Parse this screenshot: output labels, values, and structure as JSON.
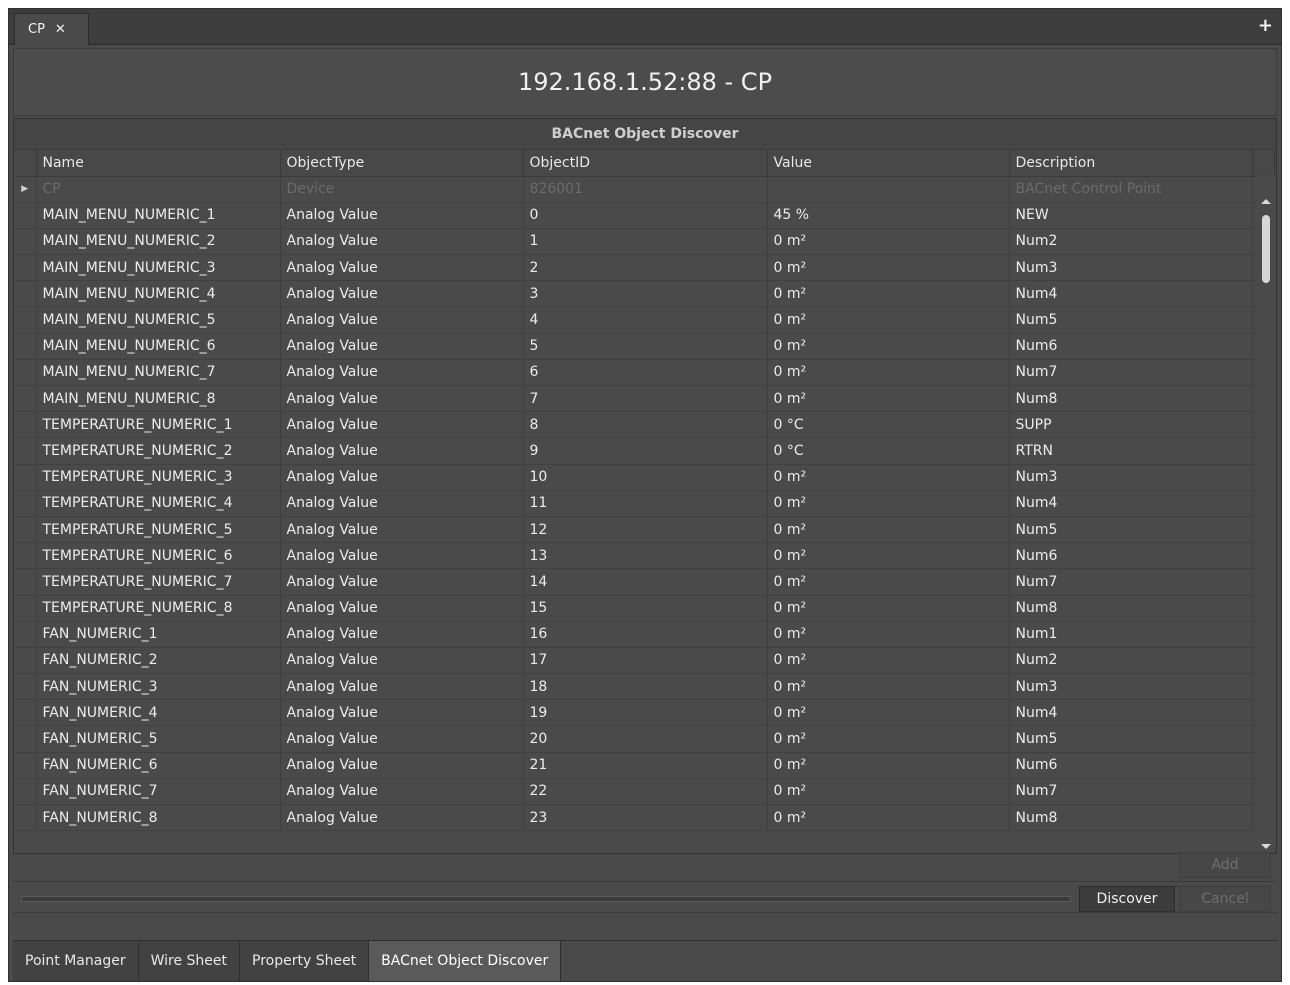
{
  "tab": {
    "label": "CP",
    "close_label": "✕",
    "add_label": "+"
  },
  "header": {
    "title": "192.168.1.52:88 - CP"
  },
  "panel": {
    "title": "BACnet Object Discover"
  },
  "columns": [
    "Name",
    "ObjectType",
    "ObjectID",
    "Value",
    "Description"
  ],
  "rows": [
    {
      "name": "CP",
      "type": "Device",
      "id": "826001",
      "value": "",
      "desc": "BACnet Control Point"
    },
    {
      "name": "MAIN_MENU_NUMERIC_1",
      "type": "Analog Value",
      "id": "0",
      "value": "45 %",
      "desc": "NEW"
    },
    {
      "name": "MAIN_MENU_NUMERIC_2",
      "type": "Analog Value",
      "id": "1",
      "value": "0 m²",
      "desc": "Num2"
    },
    {
      "name": "MAIN_MENU_NUMERIC_3",
      "type": "Analog Value",
      "id": "2",
      "value": "0 m²",
      "desc": "Num3"
    },
    {
      "name": "MAIN_MENU_NUMERIC_4",
      "type": "Analog Value",
      "id": "3",
      "value": "0 m²",
      "desc": "Num4"
    },
    {
      "name": "MAIN_MENU_NUMERIC_5",
      "type": "Analog Value",
      "id": "4",
      "value": "0 m²",
      "desc": "Num5"
    },
    {
      "name": "MAIN_MENU_NUMERIC_6",
      "type": "Analog Value",
      "id": "5",
      "value": "0 m²",
      "desc": "Num6"
    },
    {
      "name": "MAIN_MENU_NUMERIC_7",
      "type": "Analog Value",
      "id": "6",
      "value": "0 m²",
      "desc": "Num7"
    },
    {
      "name": "MAIN_MENU_NUMERIC_8",
      "type": "Analog Value",
      "id": "7",
      "value": "0 m²",
      "desc": "Num8"
    },
    {
      "name": "TEMPERATURE_NUMERIC_1",
      "type": "Analog Value",
      "id": "8",
      "value": "0 °C",
      "desc": "SUPP"
    },
    {
      "name": "TEMPERATURE_NUMERIC_2",
      "type": "Analog Value",
      "id": "9",
      "value": "0 °C",
      "desc": "RTRN"
    },
    {
      "name": "TEMPERATURE_NUMERIC_3",
      "type": "Analog Value",
      "id": "10",
      "value": "0 m²",
      "desc": "Num3"
    },
    {
      "name": "TEMPERATURE_NUMERIC_4",
      "type": "Analog Value",
      "id": "11",
      "value": "0 m²",
      "desc": "Num4"
    },
    {
      "name": "TEMPERATURE_NUMERIC_5",
      "type": "Analog Value",
      "id": "12",
      "value": "0 m²",
      "desc": "Num5"
    },
    {
      "name": "TEMPERATURE_NUMERIC_6",
      "type": "Analog Value",
      "id": "13",
      "value": "0 m²",
      "desc": "Num6"
    },
    {
      "name": "TEMPERATURE_NUMERIC_7",
      "type": "Analog Value",
      "id": "14",
      "value": "0 m²",
      "desc": "Num7"
    },
    {
      "name": "TEMPERATURE_NUMERIC_8",
      "type": "Analog Value",
      "id": "15",
      "value": "0 m²",
      "desc": "Num8"
    },
    {
      "name": "FAN_NUMERIC_1",
      "type": "Analog Value",
      "id": "16",
      "value": "0 m²",
      "desc": "Num1"
    },
    {
      "name": "FAN_NUMERIC_2",
      "type": "Analog Value",
      "id": "17",
      "value": "0 m²",
      "desc": "Num2"
    },
    {
      "name": "FAN_NUMERIC_3",
      "type": "Analog Value",
      "id": "18",
      "value": "0 m²",
      "desc": "Num3"
    },
    {
      "name": "FAN_NUMERIC_4",
      "type": "Analog Value",
      "id": "19",
      "value": "0 m²",
      "desc": "Num4"
    },
    {
      "name": "FAN_NUMERIC_5",
      "type": "Analog Value",
      "id": "20",
      "value": "0 m²",
      "desc": "Num5"
    },
    {
      "name": "FAN_NUMERIC_6",
      "type": "Analog Value",
      "id": "21",
      "value": "0 m²",
      "desc": "Num6"
    },
    {
      "name": "FAN_NUMERIC_7",
      "type": "Analog Value",
      "id": "22",
      "value": "0 m²",
      "desc": "Num7"
    },
    {
      "name": "FAN_NUMERIC_8",
      "type": "Analog Value",
      "id": "23",
      "value": "0 m²",
      "desc": "Num8"
    }
  ],
  "actions": {
    "add_label": "Add",
    "discover_label": "Discover",
    "cancel_label": "Cancel"
  },
  "bottom_tabs": [
    {
      "label": "Point Manager",
      "active": false
    },
    {
      "label": "Wire Sheet",
      "active": false
    },
    {
      "label": "Property Sheet",
      "active": false
    },
    {
      "label": "BACnet Object Discover",
      "active": true
    }
  ]
}
